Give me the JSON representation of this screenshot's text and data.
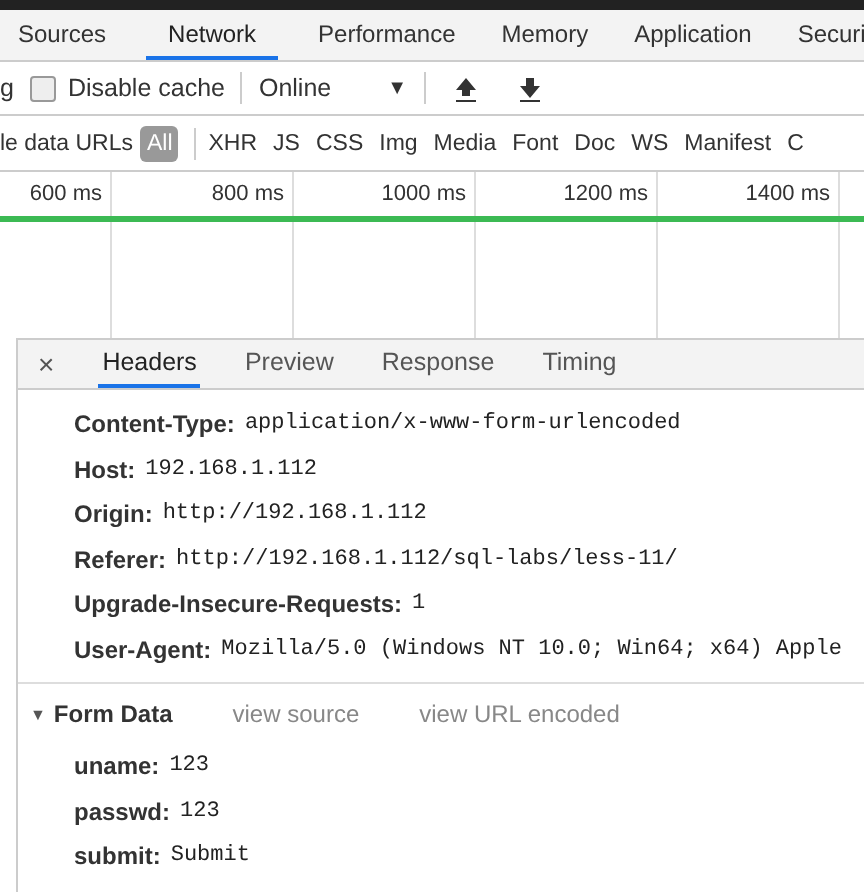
{
  "panel_tabs": [
    {
      "label": "Sources",
      "selected": false
    },
    {
      "label": "Network",
      "selected": true
    },
    {
      "label": "Performance",
      "selected": false
    },
    {
      "label": "Memory",
      "selected": false
    },
    {
      "label": "Application",
      "selected": false
    },
    {
      "label": "Securi",
      "selected": false
    }
  ],
  "toolbar": {
    "preserve_log_label": "g",
    "disable_cache": {
      "label": "Disable cache",
      "checked": false
    },
    "throttling": {
      "value": "Online",
      "caret": "▼"
    }
  },
  "filter_bar": {
    "hide_data_urls_label": "le data URLs",
    "types": [
      {
        "label": "All",
        "selected": true
      },
      {
        "label": "XHR",
        "selected": false
      },
      {
        "label": "JS",
        "selected": false
      },
      {
        "label": "CSS",
        "selected": false
      },
      {
        "label": "Img",
        "selected": false
      },
      {
        "label": "Media",
        "selected": false
      },
      {
        "label": "Font",
        "selected": false
      },
      {
        "label": "Doc",
        "selected": false
      },
      {
        "label": "WS",
        "selected": false
      },
      {
        "label": "Manifest",
        "selected": false
      },
      {
        "label": "C",
        "selected": false
      }
    ]
  },
  "timeline": {
    "ticks": [
      "600 ms",
      "800 ms",
      "1000 ms",
      "1200 ms",
      "1400 ms"
    ]
  },
  "detail": {
    "close": "×",
    "tabs": [
      {
        "label": "Headers",
        "selected": true
      },
      {
        "label": "Preview",
        "selected": false
      },
      {
        "label": "Response",
        "selected": false
      },
      {
        "label": "Timing",
        "selected": false
      }
    ],
    "request_headers": [
      {
        "name": "Content-Type:",
        "value": "application/x-www-form-urlencoded"
      },
      {
        "name": "Host:",
        "value": "192.168.1.112"
      },
      {
        "name": "Origin:",
        "value": "http://192.168.1.112"
      },
      {
        "name": "Referer:",
        "value": "http://192.168.1.112/sql-labs/less-11/"
      },
      {
        "name": "Upgrade-Insecure-Requests:",
        "value": "1"
      },
      {
        "name": "User-Agent:",
        "value": "Mozilla/5.0 (Windows NT 10.0; Win64; x64) Apple"
      }
    ],
    "form_data": {
      "toggle": "▼",
      "title": "Form Data",
      "expanded": true,
      "links": [
        "view source",
        "view URL encoded"
      ],
      "fields": [
        {
          "name": "uname:",
          "value": "123"
        },
        {
          "name": "passwd:",
          "value": "123"
        },
        {
          "name": "submit:",
          "value": "Submit"
        }
      ]
    }
  }
}
